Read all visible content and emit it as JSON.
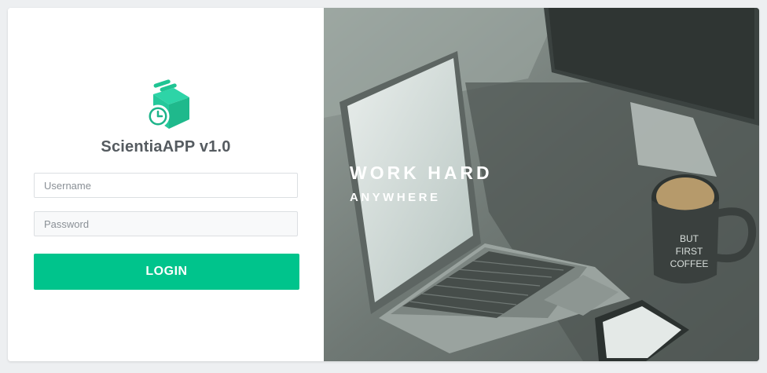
{
  "app": {
    "title": "ScientiaAPP v1.0",
    "logo_icon": "clock-box-icon",
    "accent_color": "#00c48c"
  },
  "login_form": {
    "username_placeholder": "Username",
    "username_value": "",
    "password_placeholder": "Password",
    "password_value": "",
    "login_label": "LOGIN"
  },
  "hero": {
    "headline": "WORK HARD",
    "subline": "ANYWHERE",
    "image": "laptop-desk-photo",
    "overlay_color": "#7f8985"
  },
  "mug_text": [
    "BUT",
    "FIRST",
    "COFFEE"
  ]
}
